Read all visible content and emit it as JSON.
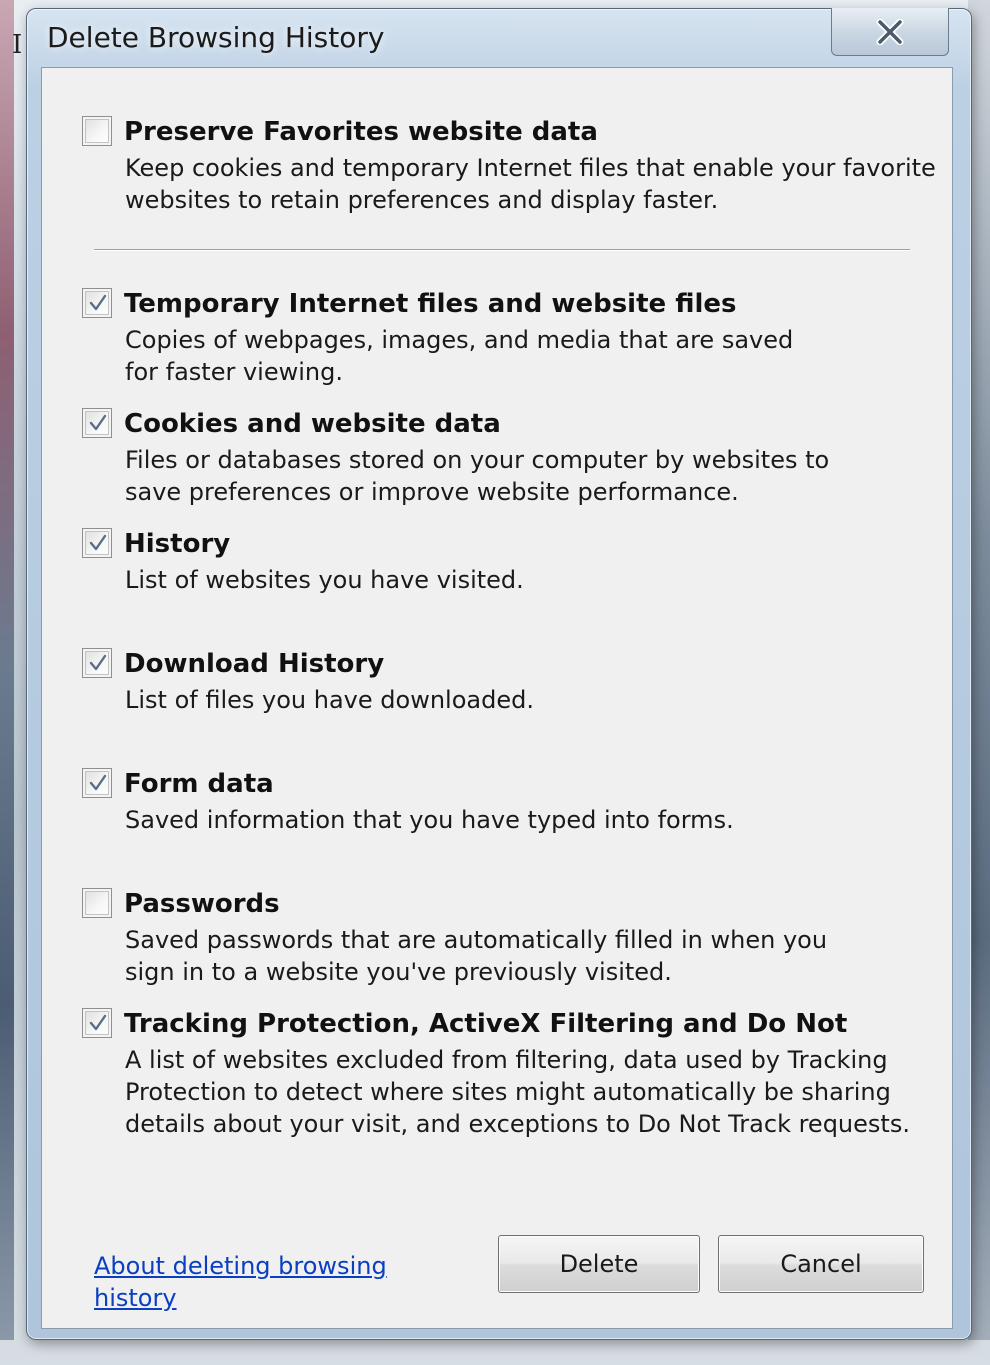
{
  "window": {
    "title": "Delete Browsing History",
    "stray_char": "I"
  },
  "options": [
    {
      "title": "Preserve Favorites website data",
      "description": "Keep cookies and temporary Internet files that enable your favorite websites to retain preferences and display faster.",
      "checked": false
    },
    {
      "title": "Temporary Internet files and website files",
      "description": "Copies of webpages, images, and media that are saved for faster viewing.",
      "checked": true
    },
    {
      "title": "Cookies and website data",
      "description": "Files or databases stored on your computer by websites to save preferences or improve website performance.",
      "checked": true
    },
    {
      "title": "History",
      "description": "List of websites you have visited.",
      "checked": true
    },
    {
      "title": "Download History",
      "description": "List of files you have downloaded.",
      "checked": true
    },
    {
      "title": "Form data",
      "description": "Saved information that you have typed into forms.",
      "checked": true
    },
    {
      "title": "Passwords",
      "description": "Saved passwords that are automatically filled in when you sign in to a website you've previously visited.",
      "checked": false
    },
    {
      "title": "Tracking Protection, ActiveX Filtering and Do Not Track d",
      "description": "A list of websites excluded from filtering, data used by Tracking Protection to detect where sites might automatically be sharing details about your visit, and exceptions to Do Not Track requests.",
      "checked": true
    }
  ],
  "footer": {
    "help_link": "About deleting browsing history",
    "delete_label": "Delete",
    "cancel_label": "Cancel"
  },
  "icons": {
    "close": "close-icon",
    "check": "checkmark-icon"
  },
  "colors": {
    "link": "#0a3fc2",
    "client_bg": "#f0f0f0",
    "frame": "#aec5dc"
  }
}
